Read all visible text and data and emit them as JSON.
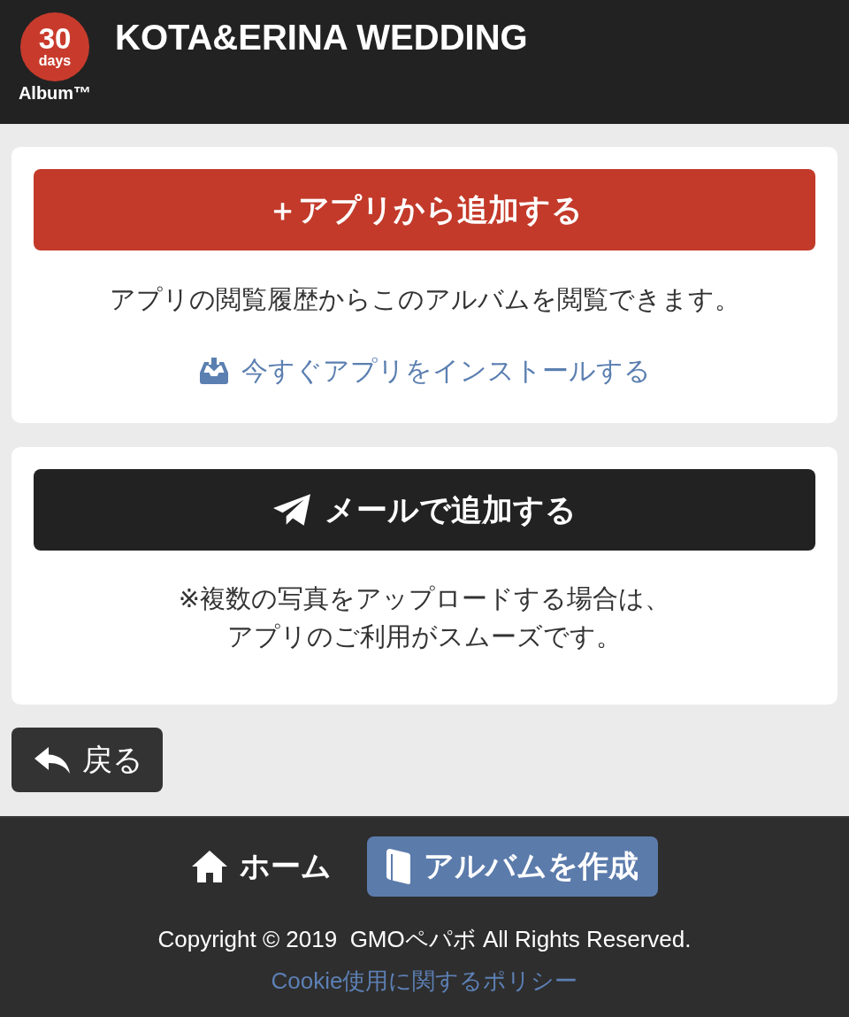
{
  "header": {
    "logo": {
      "number": "30",
      "unit": "days",
      "name": "Album™"
    },
    "title": "KOTA&ERINA WEDDING"
  },
  "app_card": {
    "button": "＋アプリから追加する",
    "description": "アプリの閲覧履歴からこのアルバムを閲覧できます。",
    "install_link": "今すぐアプリをインストールする"
  },
  "mail_card": {
    "button": "メールで追加する",
    "note_lines": [
      "※複数の写真をアップロードする場合は、",
      "アプリのご利用がスムーズです。"
    ]
  },
  "back_button": "戻る",
  "footer": {
    "nav": [
      {
        "kind": "home",
        "label": "ホーム"
      },
      {
        "kind": "create",
        "label": "アルバムを作成"
      }
    ],
    "copyright": "Copyright © 2019  GMOペパボ All Rights Reserved.",
    "cookie_link": "Cookie使用に関するポリシー"
  }
}
